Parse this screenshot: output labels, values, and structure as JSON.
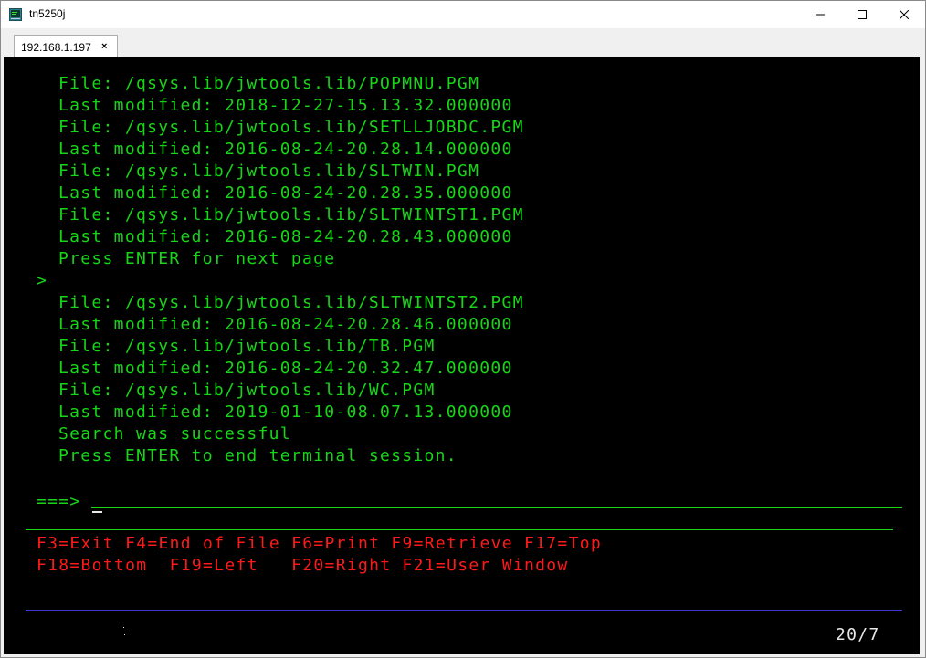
{
  "window": {
    "title": "tn5250j",
    "icon": "tn5250j-app-icon",
    "minimize_icon": "minimize-icon",
    "maximize_icon": "maximize-icon",
    "close_icon": "close-icon"
  },
  "tab": {
    "label": "192.168.1.197",
    "close": "×"
  },
  "terminal": {
    "lines": [
      "File: /qsys.lib/jwtools.lib/POPMNU.PGM",
      "Last modified: 2018-12-27-15.13.32.000000",
      "File: /qsys.lib/jwtools.lib/SETLLJOBDC.PGM",
      "Last modified: 2016-08-24-20.28.14.000000",
      "File: /qsys.lib/jwtools.lib/SLTWIN.PGM",
      "Last modified: 2016-08-24-20.28.35.000000",
      "File: /qsys.lib/jwtools.lib/SLTWINTST1.PGM",
      "Last modified: 2016-08-24-20.28.43.000000",
      "Press ENTER for next page",
      ">",
      "File: /qsys.lib/jwtools.lib/SLTWINTST2.PGM",
      "Last modified: 2016-08-24-20.28.46.000000",
      "File: /qsys.lib/jwtools.lib/TB.PGM",
      "Last modified: 2016-08-24-20.32.47.000000",
      "File: /qsys.lib/jwtools.lib/WC.PGM",
      "Last modified: 2019-01-10-08.07.13.000000",
      "Search was successful",
      "Press ENTER to end terminal session."
    ],
    "prompt": "===>",
    "command_value": "",
    "fkeys_line1": "F3=Exit F4=End of File F6=Print F9=Retrieve F17=Top",
    "fkeys_line2": "F18=Bottom  F19=Left   F20=Right F21=User Window",
    "cursor_position": "20/7",
    "colors": {
      "background": "#000000",
      "text": "#17d617",
      "function_keys": "#ff1a1a",
      "status": "#e8e8e8",
      "divider_blue": "#3a3ad0"
    }
  }
}
